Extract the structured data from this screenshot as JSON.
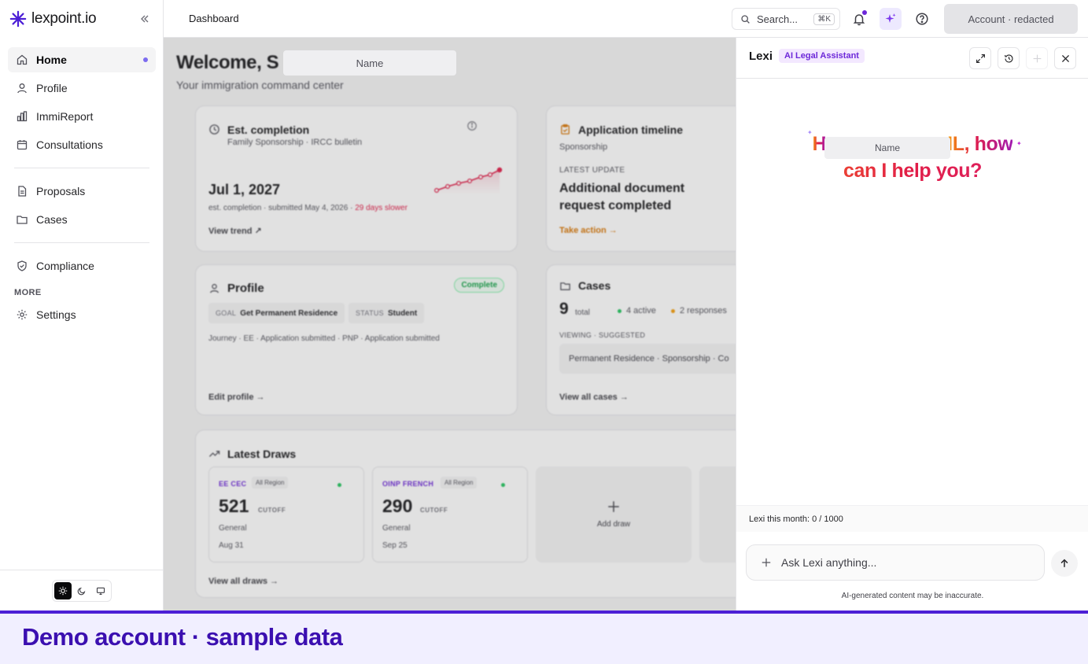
{
  "brand": {
    "name": "lexpoint.io"
  },
  "sidebar": {
    "items": [
      {
        "label": "Home",
        "active": true
      },
      {
        "label": "Profile"
      },
      {
        "label": "ImmiReport"
      },
      {
        "label": "Consultations"
      },
      {
        "label": "Proposals"
      },
      {
        "label": "Cases"
      },
      {
        "label": "Compliance"
      },
      {
        "label": "Settings"
      }
    ],
    "section_more": "MORE"
  },
  "topbar": {
    "breadcrumb": "Dashboard",
    "search_label": "Search...",
    "search_shortcut": "⌘K",
    "account_label": "Account · redacted"
  },
  "dashboard": {
    "welcome": "Welcome, S",
    "welcome_redacted": "Name",
    "subtitle": "Your immigration command center",
    "est_completion": {
      "title": "Est. completion",
      "subtitle": "Family Sponsorship · IRCC bulletin",
      "date": "Jul 1, 2027",
      "note": "est. completion · submitted May 4, 2026 · ",
      "delta": "29 days slower",
      "link": "View trend ↗"
    },
    "timeline": {
      "title": "Application timeline",
      "program": "Sponsorship",
      "update_label": "LATEST UPDATE",
      "update_text": "Additional document request completed",
      "link": "Take action →"
    },
    "profile": {
      "title": "Profile",
      "badge": "Complete",
      "goal_key": "GOAL",
      "goal_value": "Get Permanent Residence",
      "status_key": "STATUS",
      "status_value": "Student",
      "journey": "Journey · EE · Application submitted · PNP · Application submitted",
      "link": "Edit profile →"
    },
    "cases": {
      "title": "Cases",
      "total": "9",
      "total_label": "total",
      "active": "4 active",
      "responses": "2 responses",
      "viewing_label": "VIEWING · SUGGESTED",
      "suggested": "Permanent Residence · Sponsorship · Co",
      "link": "View all cases →"
    },
    "draws": {
      "title": "Latest Draws",
      "cards": [
        {
          "program": "EE CEC",
          "region": "All Region",
          "score": "521",
          "cutoff": "CUTOFF",
          "type": "General",
          "date": "Aug 31"
        },
        {
          "program": "OINP FRENCH",
          "region": "All Region",
          "score": "290",
          "cutoff": "CUTOFF",
          "type": "General",
          "date": "Sep 25"
        }
      ],
      "add_label": "Add draw",
      "link": "View all draws →"
    }
  },
  "lexi": {
    "title": "Lexi",
    "badge": "AI Legal Assistant",
    "greeting_start": "H",
    "greeting_redacted": "Name",
    "greeting_mid": "IL, how",
    "greeting_end": "can I help you?",
    "usage": "Lexi this month: 0 / 1000",
    "input_placeholder": "Ask Lexi anything...",
    "disclaimer": "AI-generated content may be inaccurate."
  },
  "banner": {
    "text": "Demo account · sample data"
  },
  "colors": {
    "accent": "#6d28d9",
    "banner": "#3b0fb0",
    "success": "#16a34a",
    "danger": "#e11d48"
  }
}
